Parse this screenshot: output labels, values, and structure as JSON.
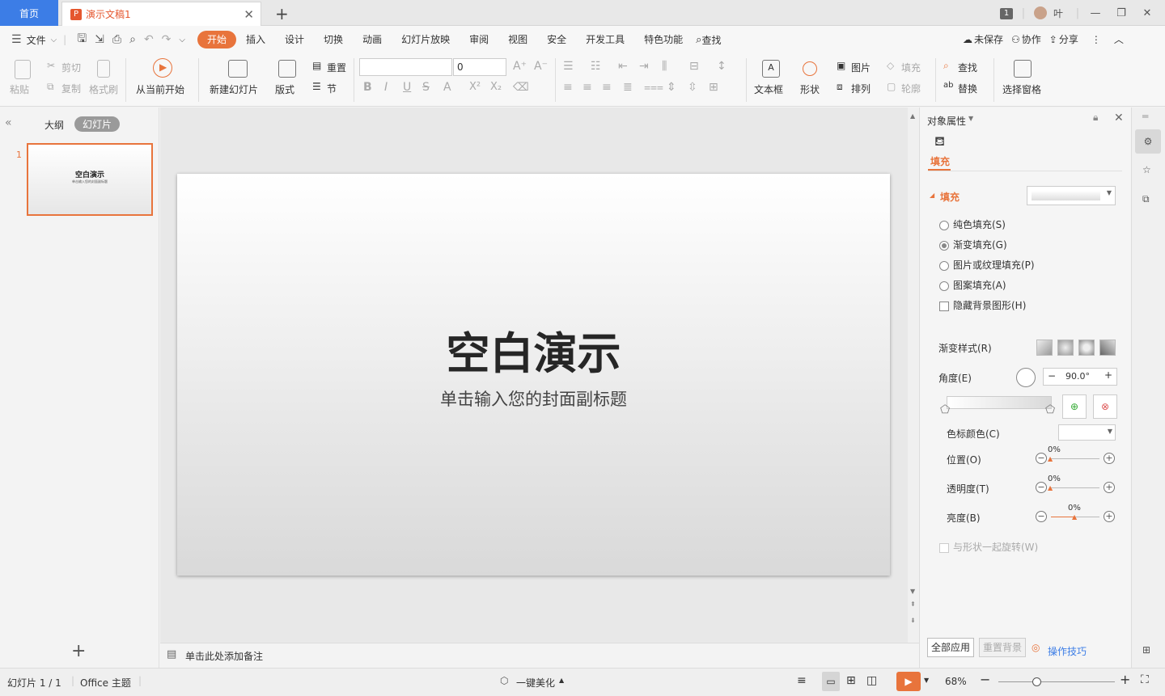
{
  "titlebar": {
    "home_tab": "首页",
    "doc_tab": "演示文稿1",
    "doc_icon": "P",
    "add_tab": "+",
    "count_badge": "1",
    "user": "叶"
  },
  "menubar": {
    "file": "文件",
    "tabs": [
      "开始",
      "插入",
      "设计",
      "切换",
      "动画",
      "幻灯片放映",
      "审阅",
      "视图",
      "安全",
      "开发工具",
      "特色功能"
    ],
    "search": "查找",
    "unsaved": "未保存",
    "collab": "协作",
    "share": "分享"
  },
  "ribbon": {
    "paste": "粘贴",
    "cut": "剪切",
    "copy": "复制",
    "format_painter": "格式刷",
    "from_current": "从当前开始",
    "new_slide": "新建幻灯片",
    "layout": "版式",
    "reset": "重置",
    "section": "节",
    "font_size": "0",
    "textbox": "文本框",
    "shape": "形状",
    "picture": "图片",
    "fill": "填充",
    "arrange": "排列",
    "outline": "轮廓",
    "find": "查找",
    "replace": "替换",
    "select_pane": "选择窗格"
  },
  "leftpanel": {
    "outline_tab": "大纲",
    "slides_tab": "幻灯片",
    "slide_number": "1",
    "thumb_title": "空白演示",
    "thumb_sub": "单击输入您的封面副标题"
  },
  "slide": {
    "title": "空白演示",
    "subtitle": "单击输入您的封面副标题"
  },
  "notes": {
    "placeholder": "单击此处添加备注"
  },
  "rightpanel": {
    "header": "对象属性",
    "tab_fill": "填充",
    "section_fill": "填充",
    "options": [
      "纯色填充(S)",
      "渐变填充(G)",
      "图片或纹理填充(P)",
      "图案填充(A)"
    ],
    "selected_option": "渐变填充(G)",
    "hide_bg": "隐藏背景图形(H)",
    "gradient_style": "渐变样式(R)",
    "angle_label": "角度(E)",
    "angle_value": "90.0°",
    "stop_color": "色标颜色(C)",
    "position_label": "位置(O)",
    "position_value": "0%",
    "transparency_label": "透明度(T)",
    "transparency_value": "0%",
    "brightness_label": "亮度(B)",
    "brightness_value": "0%",
    "rotate_with_shape": "与形状一起旋转(W)",
    "apply_all": "全部应用",
    "reset_bg": "重置背景",
    "tips": "操作技巧"
  },
  "statusbar": {
    "slide_info": "幻灯片 1 / 1",
    "theme": "Office 主题",
    "beautify": "一键美化",
    "zoom": "68%"
  },
  "colors": {
    "accent": "#e8743c",
    "home_tab": "#3c7de6",
    "link": "#3c7de6"
  }
}
